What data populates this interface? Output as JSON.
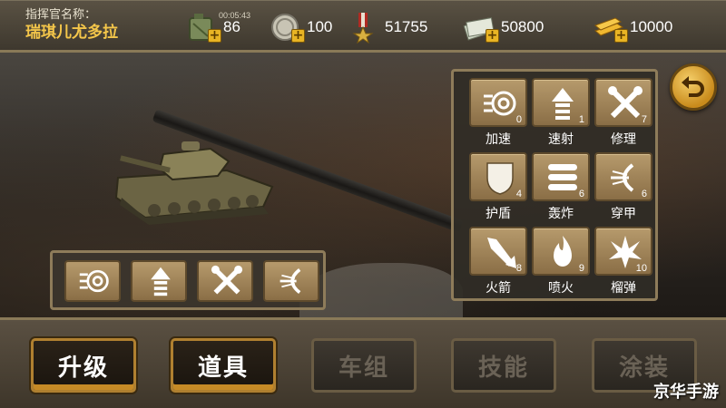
{
  "commander": {
    "label": "指挥官名称：",
    "name": "瑞琪儿尤多拉"
  },
  "resources": [
    {
      "icon": "fuel-can-icon",
      "timer": "00:05:43",
      "value": "86"
    },
    {
      "icon": "silver-coin-icon",
      "value": "100"
    },
    {
      "icon": "medal-icon",
      "value": "51755"
    },
    {
      "icon": "cash-icon",
      "value": "50800"
    },
    {
      "icon": "gold-bars-icon",
      "value": "10000"
    }
  ],
  "items": [
    {
      "label": "加速",
      "count": "0",
      "icon": "speed-boost-icon"
    },
    {
      "label": "速射",
      "count": "1",
      "icon": "rapid-fire-icon"
    },
    {
      "label": "修理",
      "count": "7",
      "icon": "repair-icon"
    },
    {
      "label": "护盾",
      "count": "4",
      "icon": "shield-icon"
    },
    {
      "label": "轰炸",
      "count": "6",
      "icon": "bombing-icon"
    },
    {
      "label": "穿甲",
      "count": "6",
      "icon": "armor-piercing-icon"
    },
    {
      "label": "火箭",
      "count": "8",
      "icon": "rocket-icon"
    },
    {
      "label": "喷火",
      "count": "9",
      "icon": "flame-icon"
    },
    {
      "label": "榴弹",
      "count": "10",
      "icon": "grenade-icon"
    }
  ],
  "equipped": [
    "speed-boost-icon",
    "rapid-fire-icon",
    "repair-icon",
    "armor-piercing-icon"
  ],
  "tabs": [
    {
      "label": "升级",
      "active": true
    },
    {
      "label": "道具",
      "active": true
    },
    {
      "label": "车组",
      "active": false
    },
    {
      "label": "技能",
      "active": false
    },
    {
      "label": "涂装",
      "active": false
    }
  ],
  "watermark": "京华手游",
  "colors": {
    "accent_gold": "#f4c64a",
    "panel_border": "#8e7c5a",
    "item_tile": "#b69a6c"
  }
}
